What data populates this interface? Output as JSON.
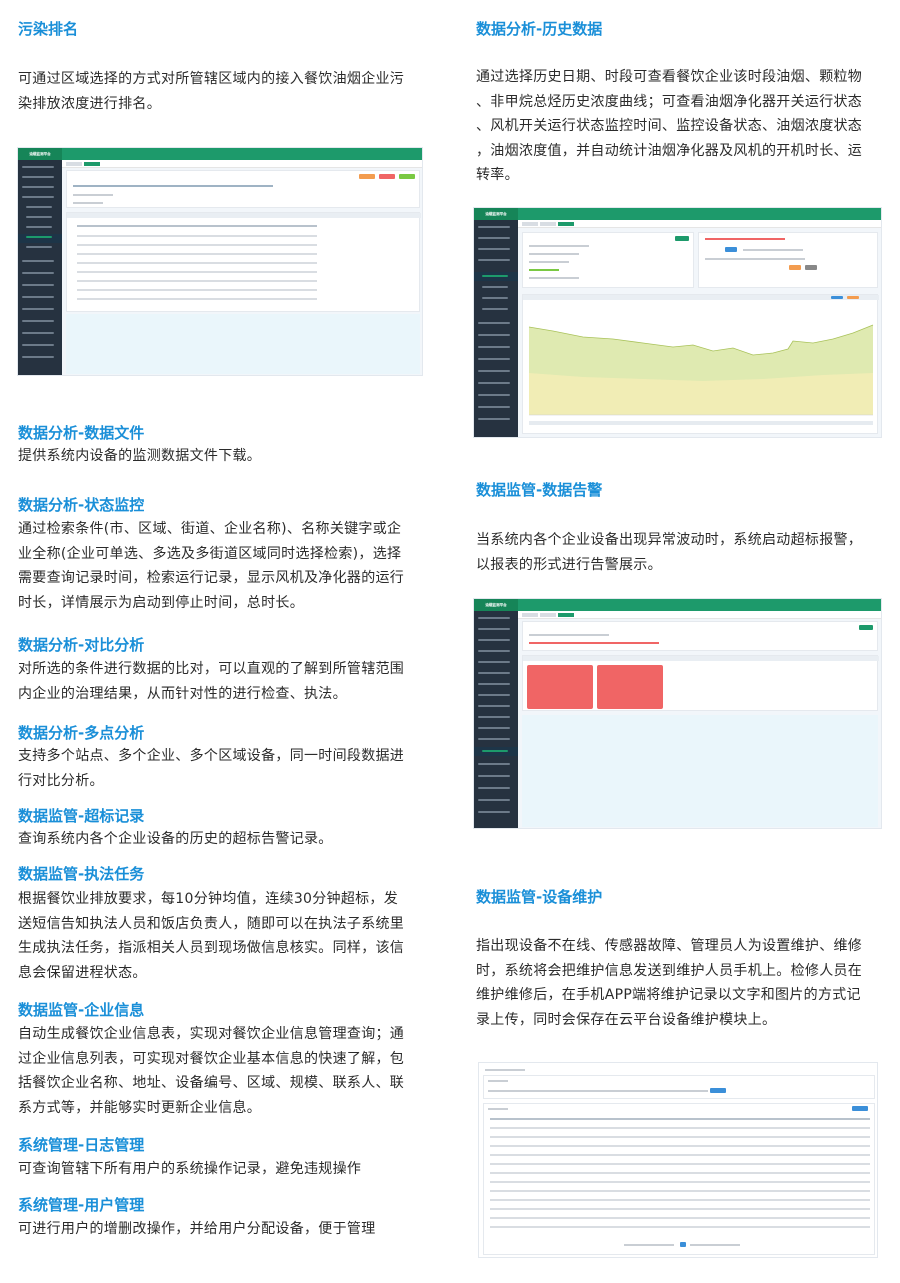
{
  "colors": {
    "heading": "#1a8fd8",
    "body": "#2b2b2b",
    "app_green": "#1d9a6b",
    "app_sidebar": "#263240",
    "alarm_red": "#f06565"
  },
  "left": {
    "pollution": {
      "title": "污染排名",
      "lines": [
        "可通过区域选择的方式对所管辖区域内的接入餐饮油烟企业污",
        "染排放浓度进行排名。"
      ]
    },
    "sections": [
      {
        "title": "数据分析-数据文件",
        "lines": [
          "提供系统内设备的监测数据文件下载。"
        ]
      },
      {
        "title": "数据分析-状态监控",
        "lines": [
          "通过检索条件(市、区域、街道、企业名称)、名称关键字或企",
          "业全称(企业可单选、多选及多街道区域同时选择检索)，选择",
          "需要查询记录时间，检索运行记录，显示风机及净化器的运行",
          "时长，详情展示为启动到停止时间，总时长。"
        ]
      },
      {
        "title": "数据分析-对比分析",
        "lines": [
          "对所选的条件进行数据的比对，可以直观的了解到所管辖范围",
          "内企业的治理结果，从而针对性的进行检查、执法。"
        ]
      },
      {
        "title": "数据分析-多点分析",
        "lines": [
          "支持多个站点、多个企业、多个区域设备，同一时间段数据进",
          "行对比分析。"
        ]
      },
      {
        "title": "数据监管-超标记录",
        "lines": [
          "查询系统内各个企业设备的历史的超标告警记录。"
        ]
      },
      {
        "title": "数据监管-执法任务",
        "lines": [
          "根据餐饮业排放要求，每10分钟均值，连续30分钟超标，发",
          "送短信告知执法人员和饭店负责人，随即可以在执法子系统里",
          "生成执法任务，指派相关人员到现场做信息核实。同样，该信",
          "息会保留进程状态。"
        ]
      },
      {
        "title": "数据监管-企业信息",
        "lines": [
          "自动生成餐饮企业信息表，实现对餐饮企业信息管理查询；通",
          "过企业信息列表，可实现对餐饮企业基本信息的快速了解，包",
          "括餐饮企业名称、地址、设备编号、区域、规模、联系人、联",
          "系方式等，并能够实时更新企业信息。"
        ]
      },
      {
        "title": "系统管理-日志管理",
        "lines": [
          "可查询管辖下所有用户的系统操作记录，避免违规操作"
        ]
      },
      {
        "title": "系统管理-用户管理",
        "lines": [
          "可进行用户的增删改操作，并给用户分配设备，便于管理"
        ]
      }
    ]
  },
  "right": {
    "history": {
      "title": "数据分析-历史数据",
      "lines": [
        "通过选择历史日期、时段可查看餐饮企业该时段油烟、颗粒物",
        "、非甲烷总烃历史浓度曲线；可查看油烟净化器开关运行状态",
        "、风机开关运行状态监控时间、监控设备状态、油烟浓度状态",
        "，油烟浓度值，并自动统计油烟净化器及风机的开机时长、运",
        "转率。"
      ]
    },
    "alarm": {
      "title": "数据监管-数据告警",
      "lines": [
        "当系统内各个企业设备出现异常波动时，系统启动超标报警，",
        "以报表的形式进行告警展示。"
      ]
    },
    "maintenance": {
      "title": "数据监管-设备维护",
      "lines": [
        "指出现设备不在线、传感器故障、管理员人为设置维护、维修",
        "时，系统将会把维护信息发送到维护人员手机上。检修人员在",
        "维护维修后，在手机APP端将维护记录以文字和图片的方式记",
        "录上传，同时会保存在云平台设备维护模块上。"
      ]
    }
  },
  "screens": {
    "app_name": "油烟监测平台"
  }
}
